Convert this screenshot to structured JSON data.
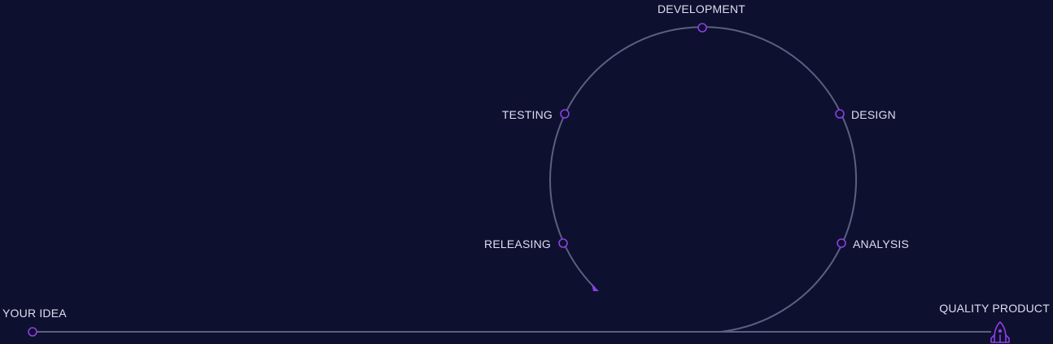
{
  "stages": {
    "start": "YOUR IDEA",
    "end": "QUALITY PRODUCT",
    "development": "DEVELOPMENT",
    "testing": "TESTING",
    "releasing": "RELEASING",
    "design": "DESIGN",
    "analysis": "ANALYSIS"
  },
  "icons": {
    "end": "rocket-icon"
  },
  "colors": {
    "background": "#0e1030",
    "path": "#5c6080",
    "accent": "#8c3fe0",
    "label": "#dcdfee"
  }
}
